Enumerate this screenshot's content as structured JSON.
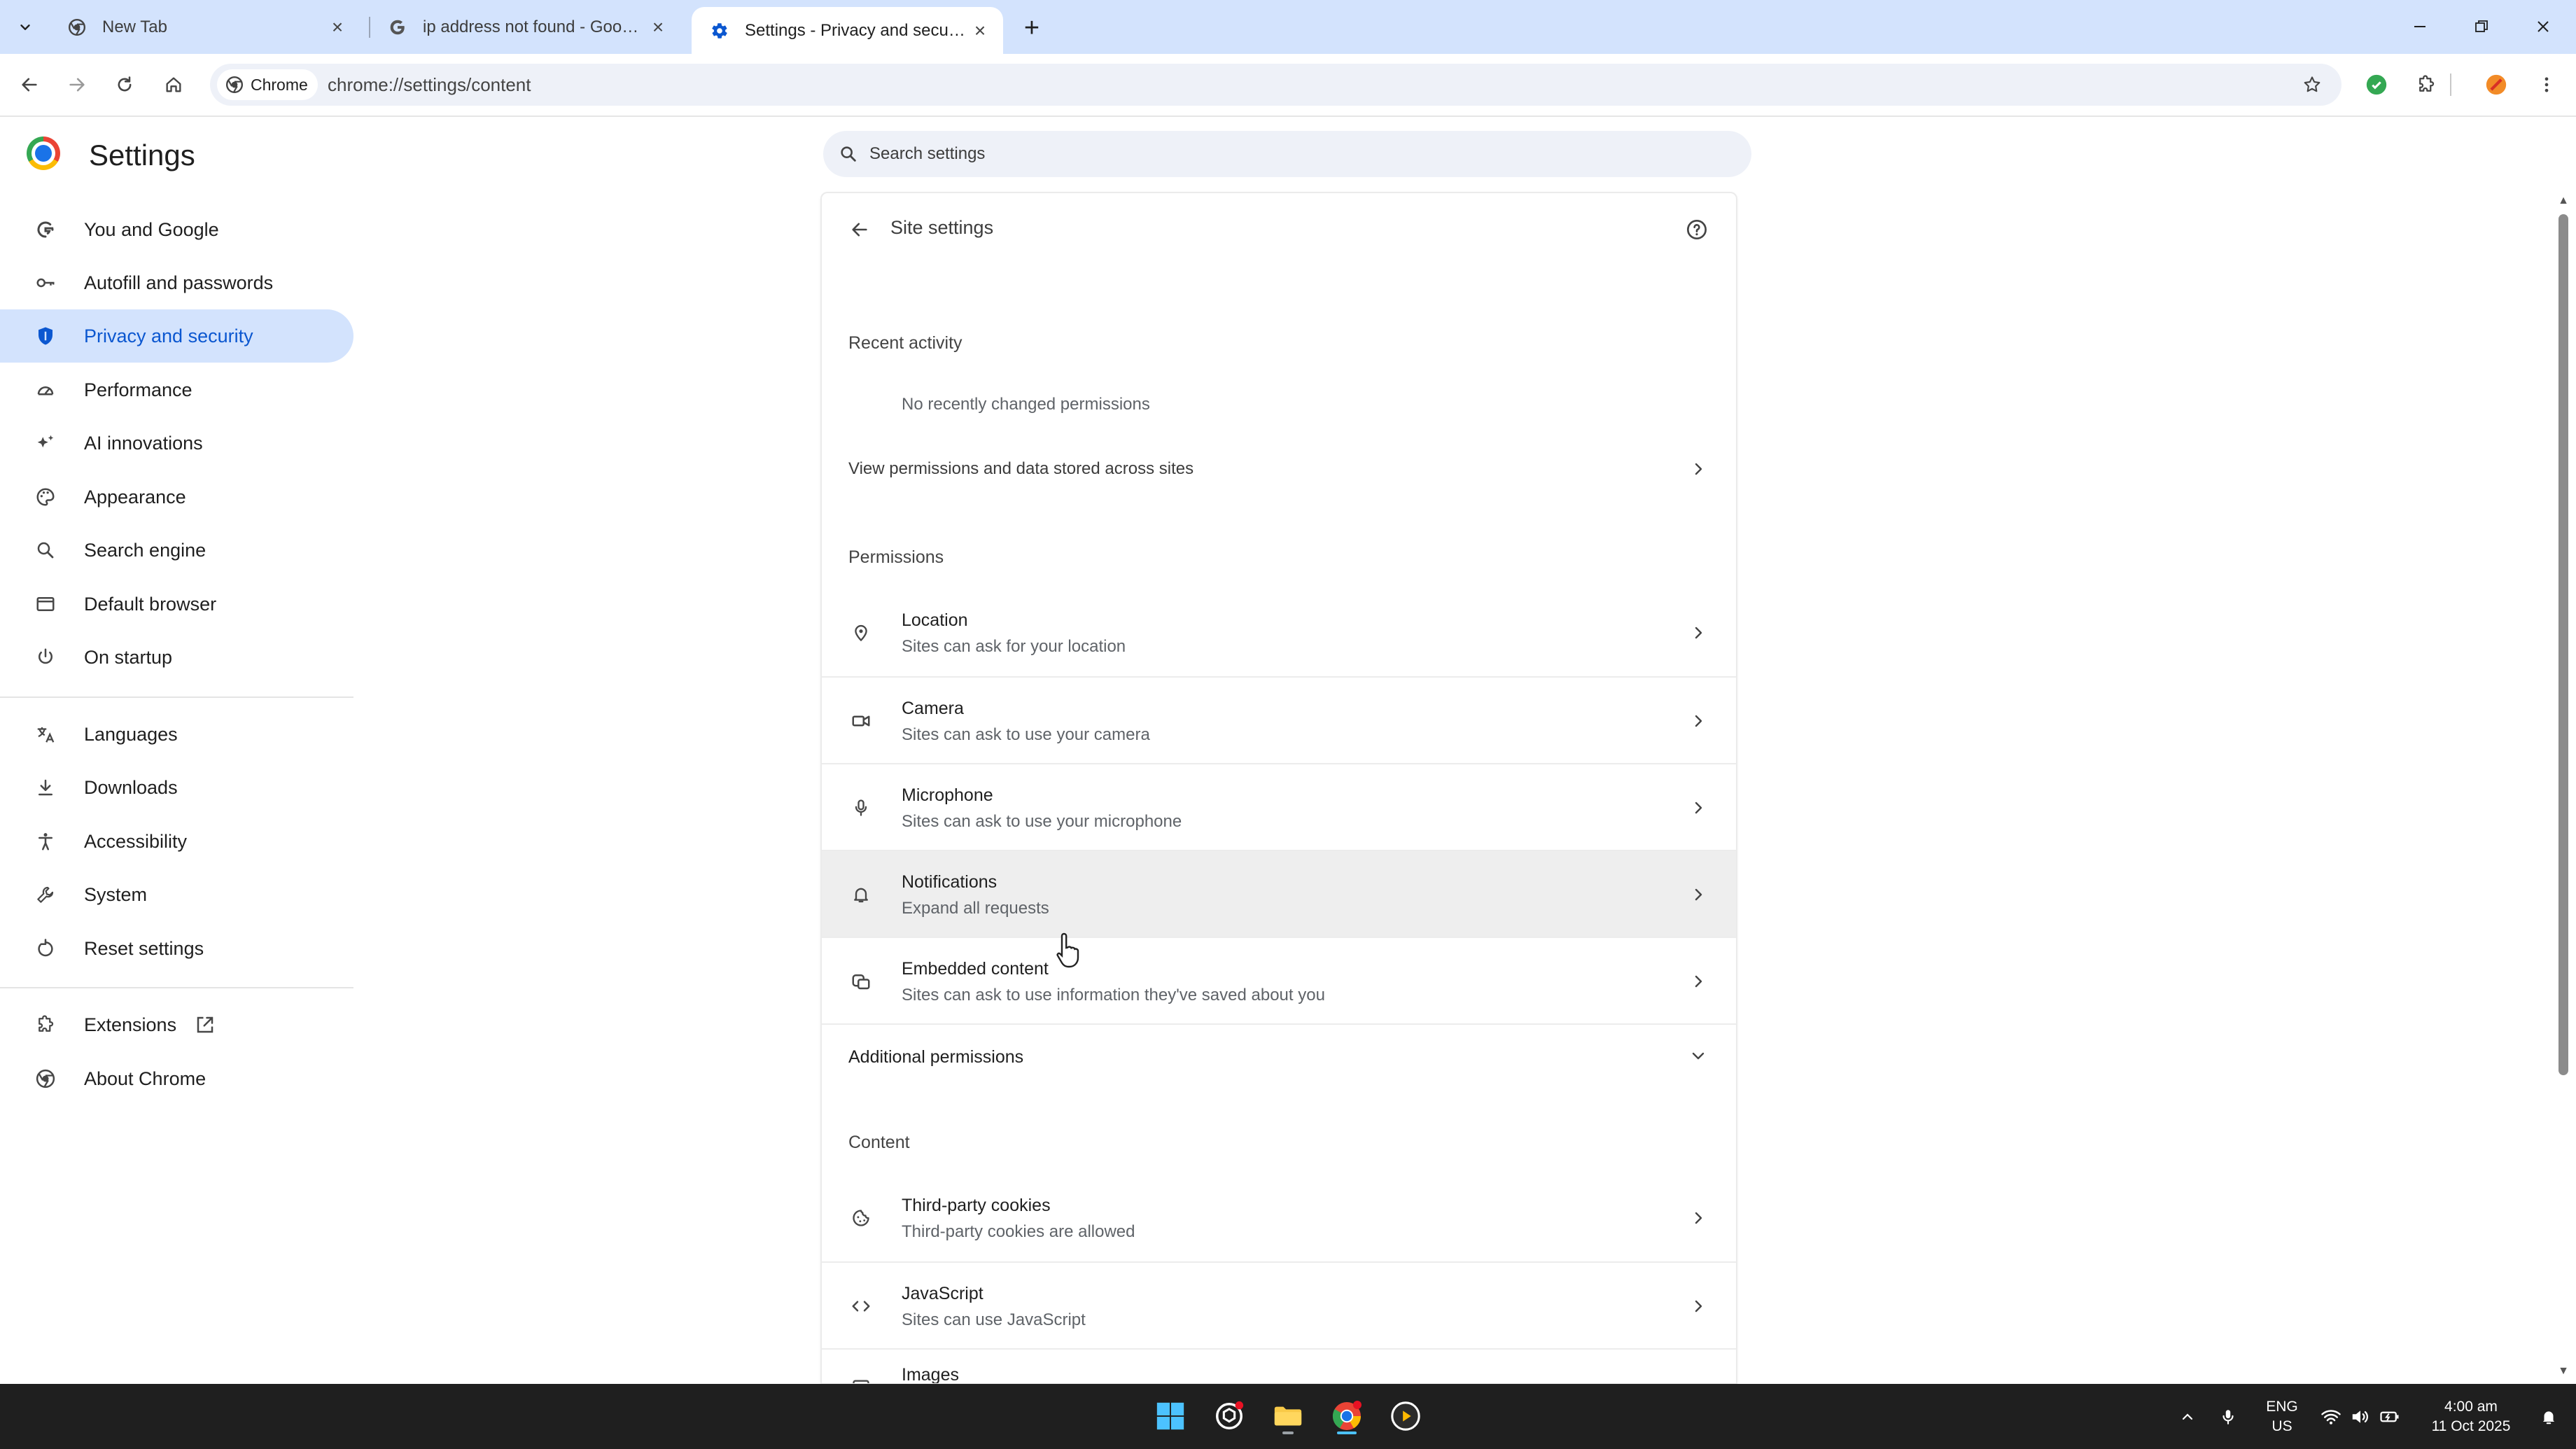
{
  "tabs": [
    {
      "title": "New Tab",
      "active": false
    },
    {
      "title": "ip address not found - Google S",
      "active": false
    },
    {
      "title": "Settings - Privacy and security",
      "active": true
    }
  ],
  "toolbar": {
    "chip_label": "Chrome",
    "url": "chrome://settings/content"
  },
  "settings": {
    "title": "Settings",
    "search_placeholder": "Search settings"
  },
  "sidebar": {
    "items": [
      {
        "label": "You and Google",
        "icon": "google-g-icon"
      },
      {
        "label": "Autofill and passwords",
        "icon": "key-icon"
      },
      {
        "label": "Privacy and security",
        "icon": "shield-icon",
        "active": true
      },
      {
        "label": "Performance",
        "icon": "speedometer-icon"
      },
      {
        "label": "AI innovations",
        "icon": "sparkle-icon"
      },
      {
        "label": "Appearance",
        "icon": "palette-icon"
      },
      {
        "label": "Search engine",
        "icon": "search-icon"
      },
      {
        "label": "Default browser",
        "icon": "browser-window-icon"
      },
      {
        "label": "On startup",
        "icon": "power-icon"
      },
      {
        "label": "Languages",
        "icon": "translate-icon"
      },
      {
        "label": "Downloads",
        "icon": "download-icon"
      },
      {
        "label": "Accessibility",
        "icon": "accessibility-icon"
      },
      {
        "label": "System",
        "icon": "wrench-icon"
      },
      {
        "label": "Reset settings",
        "icon": "reset-icon"
      },
      {
        "label": "Extensions",
        "icon": "puzzle-icon"
      },
      {
        "label": "About Chrome",
        "icon": "chrome-icon"
      }
    ]
  },
  "site_settings": {
    "title": "Site settings",
    "recent_activity_label": "Recent activity",
    "no_recent": "No recently changed permissions",
    "view_permissions": "View permissions and data stored across sites",
    "permissions_label": "Permissions",
    "permissions": [
      {
        "title": "Location",
        "subtitle": "Sites can ask for your location",
        "icon": "location-pin-icon"
      },
      {
        "title": "Camera",
        "subtitle": "Sites can ask to use your camera",
        "icon": "camera-icon"
      },
      {
        "title": "Microphone",
        "subtitle": "Sites can ask to use your microphone",
        "icon": "microphone-icon"
      },
      {
        "title": "Notifications",
        "subtitle": "Expand all requests",
        "icon": "bell-icon"
      },
      {
        "title": "Embedded content",
        "subtitle": "Sites can ask to use information they've saved about you",
        "icon": "embedded-content-icon"
      }
    ],
    "additional_permissions": "Additional permissions",
    "content_label": "Content",
    "content": [
      {
        "title": "Third-party cookies",
        "subtitle": "Third-party cookies are allowed",
        "icon": "cookie-icon"
      },
      {
        "title": "JavaScript",
        "subtitle": "Sites can use JavaScript",
        "icon": "code-icon"
      },
      {
        "title": "Images",
        "subtitle": "",
        "icon": "image-icon"
      }
    ]
  },
  "taskbar": {
    "lang_top": "ENG",
    "lang_bottom": "US",
    "time": "4:00 am",
    "date": "11 Oct 2025"
  },
  "colors": {
    "tabstrip": "#d3e3fd",
    "active_nav_bg": "#d3e3fd",
    "active_nav_text": "#0b57d0",
    "taskbar": "#1f1f1f"
  }
}
